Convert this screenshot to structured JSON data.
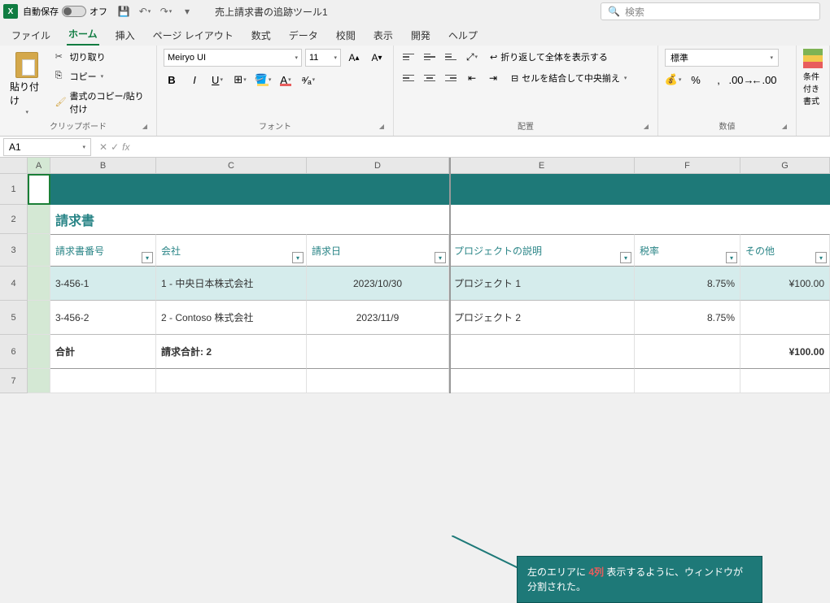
{
  "titlebar": {
    "autosave_label": "自動保存",
    "autosave_state": "オフ",
    "doc_title": "売上請求書の追跡ツール1",
    "search_placeholder": "検索"
  },
  "tabs": [
    "ファイル",
    "ホーム",
    "挿入",
    "ページ レイアウト",
    "数式",
    "データ",
    "校閲",
    "表示",
    "開発",
    "ヘルプ"
  ],
  "active_tab": 1,
  "ribbon": {
    "clipboard": {
      "label": "クリップボード",
      "paste": "貼り付け",
      "cut": "切り取り",
      "copy": "コピー",
      "format_painter": "書式のコピー/貼り付け"
    },
    "font": {
      "label": "フォント",
      "name": "Meiryo UI",
      "size": "11"
    },
    "alignment": {
      "label": "配置",
      "wrap": "折り返して全体を表示する",
      "merge": "セルを結合して中央揃え"
    },
    "number": {
      "label": "数値",
      "format": "標準"
    },
    "styles": {
      "cond_fmt": "条件付き書式"
    }
  },
  "namebox": "A1",
  "columns": [
    "A",
    "B",
    "C",
    "D",
    "E",
    "F",
    "G"
  ],
  "rows": [
    "1",
    "2",
    "3",
    "4",
    "5",
    "6",
    "7"
  ],
  "sheet": {
    "heading": "請求書",
    "headers": [
      "請求書番号",
      "会社",
      "請求日",
      "プロジェクトの説明",
      "税率",
      "その他"
    ],
    "data": [
      {
        "invoice": "3-456-1",
        "company": "1 - 中央日本株式会社",
        "date": "2023/10/30",
        "project": "プロジェクト 1",
        "tax": "8.75%",
        "other": "¥100.00"
      },
      {
        "invoice": "3-456-2",
        "company": "2 - Contoso 株式会社",
        "date": "2023/11/9",
        "project": "プロジェクト 2",
        "tax": "8.75%",
        "other": ""
      }
    ],
    "totals": {
      "label": "合計",
      "count": "請求合計: 2",
      "other": "¥100.00"
    }
  },
  "callout": {
    "pre": "左のエリアに ",
    "highlight": "4列",
    "post": " 表示するように、ウィンドウが分割された。"
  }
}
